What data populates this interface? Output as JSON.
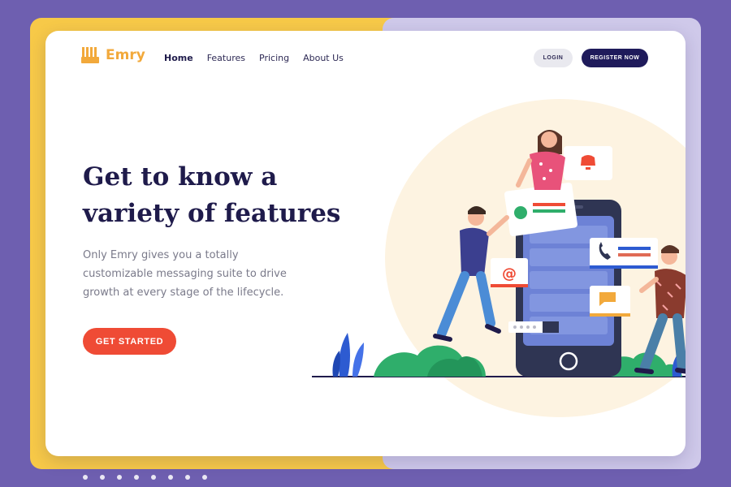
{
  "brand": {
    "name": "Emry",
    "accent": "#f2a93b"
  },
  "nav": {
    "items": [
      {
        "label": "Home",
        "active": true
      },
      {
        "label": "Features",
        "active": false
      },
      {
        "label": "Pricing",
        "active": false
      },
      {
        "label": "About Us",
        "active": false
      }
    ]
  },
  "header": {
    "login_label": "LOGIN",
    "register_label": "REGISTER NOW"
  },
  "hero": {
    "headline": "Get to know a variety of features",
    "subtext": "Only Emry gives you a totally customizable messaging suite to drive growth at every stage of the lifecycle.",
    "cta_label": "GET STARTED"
  },
  "colors": {
    "background": "#6e5fb0",
    "yellow_panel": "#f7c948",
    "lilac_panel": "#cfc9ea",
    "dark_navy": "#1f1b5b",
    "cta_red": "#ef4b35"
  },
  "pager": {
    "dot_count": 8
  }
}
